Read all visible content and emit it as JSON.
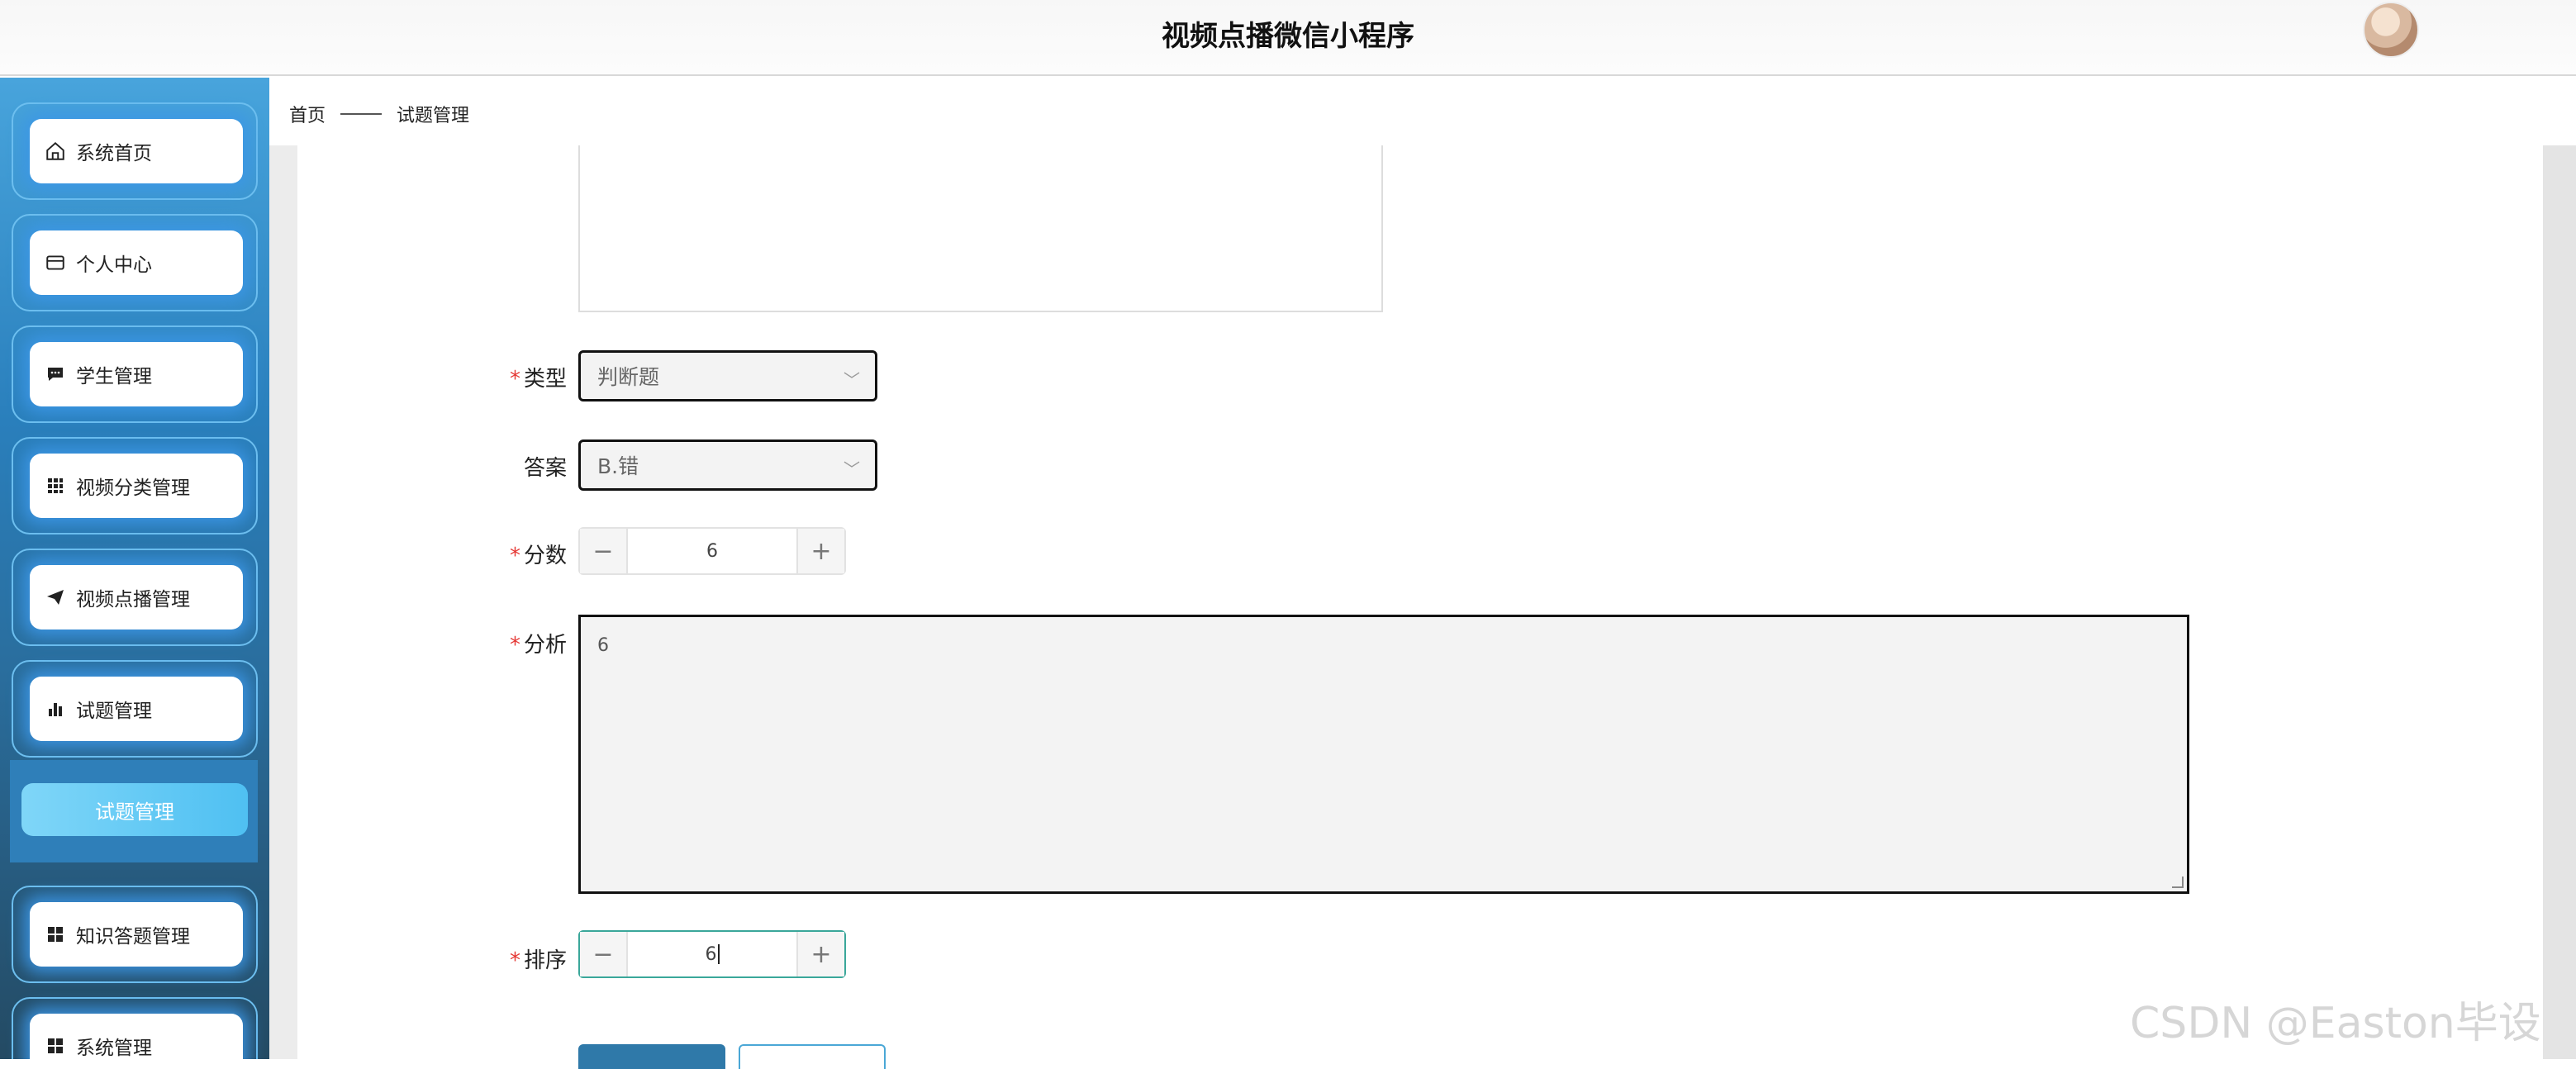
{
  "header": {
    "title": "视频点播微信小程序"
  },
  "sidebar": {
    "items": [
      {
        "label": "系统首页",
        "icon": "home-icon"
      },
      {
        "label": "个人中心",
        "icon": "card-icon"
      },
      {
        "label": "学生管理",
        "icon": "chat-icon"
      },
      {
        "label": "视频分类管理",
        "icon": "grid-icon"
      },
      {
        "label": "视频点播管理",
        "icon": "send-icon"
      },
      {
        "label": "试题管理",
        "icon": "bar-chart-icon"
      },
      {
        "label": "知识答题管理",
        "icon": "apps-icon"
      },
      {
        "label": "系统管理",
        "icon": "apps-icon"
      }
    ],
    "submenu": {
      "label": "试题管理"
    }
  },
  "breadcrumb": {
    "home": "首页",
    "current": "试题管理"
  },
  "form": {
    "type": {
      "label": "类型",
      "value": "判断题",
      "required": true
    },
    "answer": {
      "label": "答案",
      "value": "B.错",
      "required": false
    },
    "score": {
      "label": "分数",
      "value": "6",
      "required": true
    },
    "analysis": {
      "label": "分析",
      "value": "6",
      "required": true
    },
    "order": {
      "label": "排序",
      "value": "6",
      "required": true
    }
  },
  "watermark": "CSDN @Easton毕设"
}
